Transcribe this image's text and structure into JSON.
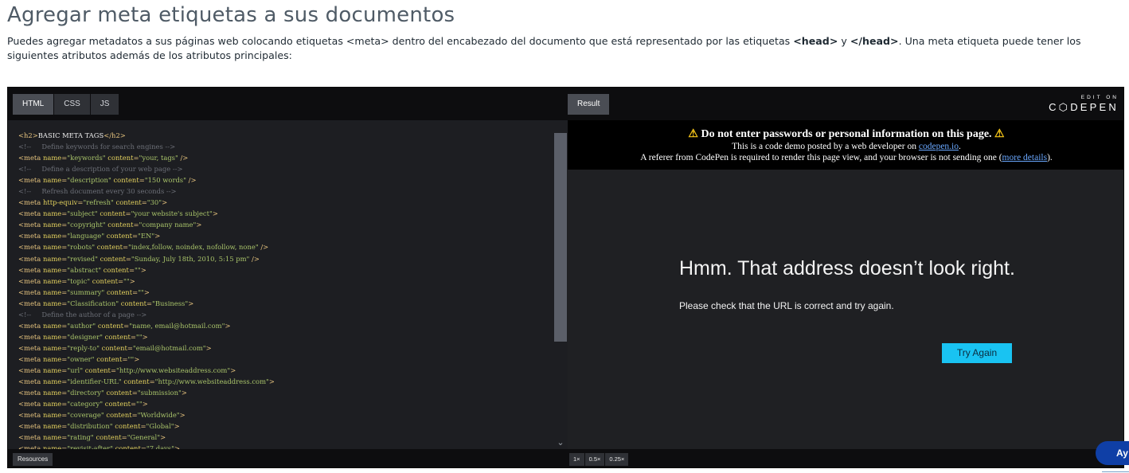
{
  "page": {
    "title": "Agregar meta etiquetas a sus documentos",
    "intro_part1": "Puedes agregar metadatos a sus páginas web colocando etiquetas <meta> dentro del encabezado del documento que está representado por las etiquetas ",
    "intro_head_open": "<head>",
    "intro_y": " y ",
    "intro_head_close": "</head>",
    "intro_part2": ". Una meta etiqueta puede tener los siguientes atributos además de los atributos principales:"
  },
  "editor": {
    "tabs": [
      {
        "label": "HTML",
        "active": true
      },
      {
        "label": "CSS",
        "active": false
      },
      {
        "label": "JS",
        "active": false
      }
    ],
    "resources_label": "Resources",
    "code_lines": [
      [
        [
          "t",
          "<h2>"
        ],
        [
          "p",
          "BASIC META TAGS"
        ],
        [
          "t",
          "</h2>"
        ]
      ],
      [
        [
          "c",
          "<!--     Define keywords for search engines -->"
        ]
      ],
      [
        [
          "t",
          "<meta "
        ],
        [
          "a",
          "name"
        ],
        [
          "t",
          "="
        ],
        [
          "s",
          "\"keywords\""
        ],
        [
          "t",
          " "
        ],
        [
          "a",
          "content"
        ],
        [
          "t",
          "="
        ],
        [
          "s",
          "\"your, tags\""
        ],
        [
          "t",
          " />"
        ]
      ],
      [
        [
          "c",
          "<!--     Define a description of your web page -->"
        ]
      ],
      [
        [
          "t",
          "<meta "
        ],
        [
          "a",
          "name"
        ],
        [
          "t",
          "="
        ],
        [
          "s",
          "\"description\""
        ],
        [
          "t",
          " "
        ],
        [
          "a",
          "content"
        ],
        [
          "t",
          "="
        ],
        [
          "s",
          "\"150 words\""
        ],
        [
          "t",
          " />"
        ]
      ],
      [
        [
          "c",
          "<!--     Refresh document every 30 seconds -->"
        ]
      ],
      [
        [
          "t",
          "<meta "
        ],
        [
          "a",
          "http-equiv"
        ],
        [
          "t",
          "="
        ],
        [
          "s",
          "\"refresh\""
        ],
        [
          "t",
          " "
        ],
        [
          "a",
          "content"
        ],
        [
          "t",
          "="
        ],
        [
          "s",
          "\"30\""
        ],
        [
          "t",
          ">"
        ]
      ],
      [
        [
          "t",
          "<meta "
        ],
        [
          "a",
          "name"
        ],
        [
          "t",
          "="
        ],
        [
          "s",
          "\"subject\""
        ],
        [
          "t",
          " "
        ],
        [
          "a",
          "content"
        ],
        [
          "t",
          "="
        ],
        [
          "s",
          "\"your website's subject\""
        ],
        [
          "t",
          ">"
        ]
      ],
      [
        [
          "t",
          "<meta "
        ],
        [
          "a",
          "name"
        ],
        [
          "t",
          "="
        ],
        [
          "s",
          "\"copyright\""
        ],
        [
          "t",
          " "
        ],
        [
          "a",
          "content"
        ],
        [
          "t",
          "="
        ],
        [
          "s",
          "\"company name\""
        ],
        [
          "t",
          ">"
        ]
      ],
      [
        [
          "t",
          "<meta "
        ],
        [
          "a",
          "name"
        ],
        [
          "t",
          "="
        ],
        [
          "s",
          "\"language\""
        ],
        [
          "t",
          " "
        ],
        [
          "a",
          "content"
        ],
        [
          "t",
          "="
        ],
        [
          "s",
          "\"EN\""
        ],
        [
          "t",
          ">"
        ]
      ],
      [
        [
          "t",
          "<meta "
        ],
        [
          "a",
          "name"
        ],
        [
          "t",
          "="
        ],
        [
          "s",
          "\"robots\""
        ],
        [
          "t",
          " "
        ],
        [
          "a",
          "content"
        ],
        [
          "t",
          "="
        ],
        [
          "s",
          "\"index,follow, noindex, nofollow, none\""
        ],
        [
          "t",
          " />"
        ]
      ],
      [
        [
          "t",
          "<meta "
        ],
        [
          "a",
          "name"
        ],
        [
          "t",
          "="
        ],
        [
          "s",
          "\"revised\""
        ],
        [
          "t",
          " "
        ],
        [
          "a",
          "content"
        ],
        [
          "t",
          "="
        ],
        [
          "s",
          "\"Sunday, July 18th, 2010, 5:15 pm\""
        ],
        [
          "t",
          " />"
        ]
      ],
      [
        [
          "t",
          "<meta "
        ],
        [
          "a",
          "name"
        ],
        [
          "t",
          "="
        ],
        [
          "s",
          "\"abstract\""
        ],
        [
          "t",
          " "
        ],
        [
          "a",
          "content"
        ],
        [
          "t",
          "="
        ],
        [
          "s",
          "\"\""
        ],
        [
          "t",
          ">"
        ]
      ],
      [
        [
          "t",
          "<meta "
        ],
        [
          "a",
          "name"
        ],
        [
          "t",
          "="
        ],
        [
          "s",
          "\"topic\""
        ],
        [
          "t",
          " "
        ],
        [
          "a",
          "content"
        ],
        [
          "t",
          "="
        ],
        [
          "s",
          "\"\""
        ],
        [
          "t",
          ">"
        ]
      ],
      [
        [
          "t",
          "<meta "
        ],
        [
          "a",
          "name"
        ],
        [
          "t",
          "="
        ],
        [
          "s",
          "\"summary\""
        ],
        [
          "t",
          " "
        ],
        [
          "a",
          "content"
        ],
        [
          "t",
          "="
        ],
        [
          "s",
          "\"\""
        ],
        [
          "t",
          ">"
        ]
      ],
      [
        [
          "t",
          "<meta "
        ],
        [
          "a",
          "name"
        ],
        [
          "t",
          "="
        ],
        [
          "s",
          "\"Classification\""
        ],
        [
          "t",
          " "
        ],
        [
          "a",
          "content"
        ],
        [
          "t",
          "="
        ],
        [
          "s",
          "\"Business\""
        ],
        [
          "t",
          ">"
        ]
      ],
      [
        [
          "c",
          "<!--     Define the author of a page -->"
        ]
      ],
      [
        [
          "t",
          "<meta "
        ],
        [
          "a",
          "name"
        ],
        [
          "t",
          "="
        ],
        [
          "s",
          "\"author\""
        ],
        [
          "t",
          " "
        ],
        [
          "a",
          "content"
        ],
        [
          "t",
          "="
        ],
        [
          "s",
          "\"name, email@hotmail.com\""
        ],
        [
          "t",
          ">"
        ]
      ],
      [
        [
          "t",
          "<meta "
        ],
        [
          "a",
          "name"
        ],
        [
          "t",
          "="
        ],
        [
          "s",
          "\"designer\""
        ],
        [
          "t",
          " "
        ],
        [
          "a",
          "content"
        ],
        [
          "t",
          "="
        ],
        [
          "s",
          "\"\""
        ],
        [
          "t",
          ">"
        ]
      ],
      [
        [
          "t",
          "<meta "
        ],
        [
          "a",
          "name"
        ],
        [
          "t",
          "="
        ],
        [
          "s",
          "\"reply-to\""
        ],
        [
          "t",
          " "
        ],
        [
          "a",
          "content"
        ],
        [
          "t",
          "="
        ],
        [
          "s",
          "\"email@hotmail.com\""
        ],
        [
          "t",
          ">"
        ]
      ],
      [
        [
          "t",
          "<meta "
        ],
        [
          "a",
          "name"
        ],
        [
          "t",
          "="
        ],
        [
          "s",
          "\"owner\""
        ],
        [
          "t",
          " "
        ],
        [
          "a",
          "content"
        ],
        [
          "t",
          "="
        ],
        [
          "s",
          "\"\""
        ],
        [
          "t",
          ">"
        ]
      ],
      [
        [
          "t",
          "<meta "
        ],
        [
          "a",
          "name"
        ],
        [
          "t",
          "="
        ],
        [
          "s",
          "\"url\""
        ],
        [
          "t",
          " "
        ],
        [
          "a",
          "content"
        ],
        [
          "t",
          "="
        ],
        [
          "s",
          "\"http://www.websiteaddress.com\""
        ],
        [
          "t",
          ">"
        ]
      ],
      [
        [
          "t",
          "<meta "
        ],
        [
          "a",
          "name"
        ],
        [
          "t",
          "="
        ],
        [
          "s",
          "\"identifier-URL\""
        ],
        [
          "t",
          " "
        ],
        [
          "a",
          "content"
        ],
        [
          "t",
          "="
        ],
        [
          "s",
          "\"http://www.websiteaddress.com\""
        ],
        [
          "t",
          ">"
        ]
      ],
      [
        [
          "t",
          "<meta "
        ],
        [
          "a",
          "name"
        ],
        [
          "t",
          "="
        ],
        [
          "s",
          "\"directory\""
        ],
        [
          "t",
          " "
        ],
        [
          "a",
          "content"
        ],
        [
          "t",
          "="
        ],
        [
          "s",
          "\"submission\""
        ],
        [
          "t",
          ">"
        ]
      ],
      [
        [
          "t",
          "<meta "
        ],
        [
          "a",
          "name"
        ],
        [
          "t",
          "="
        ],
        [
          "s",
          "\"category\""
        ],
        [
          "t",
          " "
        ],
        [
          "a",
          "content"
        ],
        [
          "t",
          "="
        ],
        [
          "s",
          "\"\""
        ],
        [
          "t",
          ">"
        ]
      ],
      [
        [
          "t",
          "<meta "
        ],
        [
          "a",
          "name"
        ],
        [
          "t",
          "="
        ],
        [
          "s",
          "\"coverage\""
        ],
        [
          "t",
          " "
        ],
        [
          "a",
          "content"
        ],
        [
          "t",
          "="
        ],
        [
          "s",
          "\"Worldwide\""
        ],
        [
          "t",
          ">"
        ]
      ],
      [
        [
          "t",
          "<meta "
        ],
        [
          "a",
          "name"
        ],
        [
          "t",
          "="
        ],
        [
          "s",
          "\"distribution\""
        ],
        [
          "t",
          " "
        ],
        [
          "a",
          "content"
        ],
        [
          "t",
          "="
        ],
        [
          "s",
          "\"Global\""
        ],
        [
          "t",
          ">"
        ]
      ],
      [
        [
          "t",
          "<meta "
        ],
        [
          "a",
          "name"
        ],
        [
          "t",
          "="
        ],
        [
          "s",
          "\"rating\""
        ],
        [
          "t",
          " "
        ],
        [
          "a",
          "content"
        ],
        [
          "t",
          "="
        ],
        [
          "s",
          "\"General\""
        ],
        [
          "t",
          ">"
        ]
      ],
      [
        [
          "t",
          "<meta "
        ],
        [
          "a",
          "name"
        ],
        [
          "t",
          "="
        ],
        [
          "s",
          "\"revisit-after\""
        ],
        [
          "t",
          " "
        ],
        [
          "a",
          "content"
        ],
        [
          "t",
          "="
        ],
        [
          "s",
          "\"7 days\""
        ],
        [
          "t",
          ">"
        ]
      ]
    ]
  },
  "result": {
    "tab_label": "Result",
    "edit_on": "EDIT ON",
    "codepen": "C⬡DEPEN",
    "warning_title": "Do not enter passwords or personal information on this page.",
    "warning_line1_a": "This is a code demo posted by a web developer on ",
    "warning_line1_link": "codepen.io",
    "warning_line1_b": ".",
    "warning_line2_a": "A referer from CodePen is required to render this page view, and your browser is not sending one (",
    "warning_line2_link": "more details",
    "warning_line2_b": ").",
    "error_title": "Hmm. That address doesn’t look right.",
    "error_message": "Please check that the URL is correct and try again.",
    "try_again": "Try Again",
    "zoom_options": [
      "1×",
      "0.5×",
      "0.25×"
    ]
  },
  "badge": {
    "label": "Ay"
  },
  "colors": {
    "accent": "#19c3f2",
    "badge": "#0f3fa6",
    "warning": "#f5c518",
    "tag": "#e8c57f",
    "attribute": "#e3d15e",
    "string": "#a9c46a",
    "comment": "#6c6f77"
  }
}
